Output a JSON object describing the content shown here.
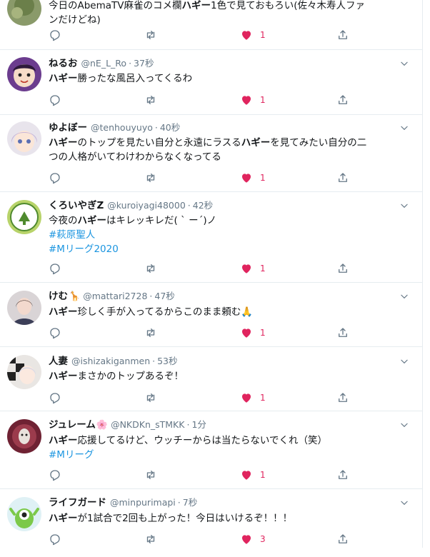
{
  "colors": {
    "accent": "#1b95e0",
    "like": "#e0245e",
    "muted": "#657786",
    "text": "#14171a",
    "divider": "#e6ecf0"
  },
  "icons": [
    "reply-icon",
    "retweet-icon",
    "heart-icon",
    "share-icon",
    "chevron-down-icon"
  ],
  "top_partial": {
    "text_part1": "今日のAbemaTV麻雀のコメ欄",
    "text_bold": "ハギー",
    "text_part2": "1色で見ておもろい(佐々木寿人ファ",
    "text_line2": "ンだけどね)",
    "likes": "1"
  },
  "tweets": [
    {
      "name": "ねるお",
      "handle": "@nE_L_Ro",
      "time": "37秒",
      "name_emoji": "",
      "lines": [
        [
          {
            "t": "ハギー",
            "b": true
          },
          {
            "t": "勝ったな風呂入ってくるわ"
          }
        ]
      ],
      "tags": [],
      "likes": "1"
    },
    {
      "name": "ゆよぼー",
      "handle": "@tenhouyuyo",
      "time": "40秒",
      "name_emoji": "",
      "lines": [
        [
          {
            "t": "ハギー",
            "b": true
          },
          {
            "t": "のトップを見たい自分と永遠にラスる"
          },
          {
            "t": "ハギー",
            "b": true
          },
          {
            "t": "を見てみたい自分の二"
          }
        ],
        [
          {
            "t": "つの人格がいてわけわからなくなってる"
          }
        ]
      ],
      "tags": [],
      "likes": "1"
    },
    {
      "name": "くろいやぎZ",
      "handle": "@kuroiyagi48000",
      "time": "42秒",
      "name_emoji": "",
      "lines": [
        [
          {
            "t": "今夜の"
          },
          {
            "t": "ハギー",
            "b": true
          },
          {
            "t": "はキレッキレだ( ˋ ー´)ノ"
          }
        ]
      ],
      "tags": [
        "#萩原聖人",
        "#Mリーグ2020"
      ],
      "likes": "1"
    },
    {
      "name": "けむ",
      "handle": "@mattari2728",
      "time": "47秒",
      "name_emoji": "🦒",
      "lines": [
        [
          {
            "t": "ハギー",
            "b": true
          },
          {
            "t": "珍しく手が入ってるからこのまま頼む🙏"
          }
        ]
      ],
      "tags": [],
      "likes": "1"
    },
    {
      "name": "人妻",
      "handle": "@ishizakiganmen",
      "time": "53秒",
      "name_emoji": "",
      "lines": [
        [
          {
            "t": "ハギー",
            "b": true
          },
          {
            "t": "まさかのトップあるぞ！"
          }
        ]
      ],
      "tags": [],
      "likes": "1"
    },
    {
      "name": "ジュレーム",
      "handle": "@NKDKn_sTMKK",
      "time": "1分",
      "name_emoji": "🌸",
      "lines": [
        [
          {
            "t": "ハギー",
            "b": true
          },
          {
            "t": "応援してるけど、ウッチーからは当たらないでくれ（笑）"
          }
        ]
      ],
      "tags": [
        "#Mリーグ"
      ],
      "likes": "1"
    },
    {
      "name": "ライフガード",
      "handle": "@minpurimapi",
      "time": "7秒",
      "name_emoji": "",
      "lines": [
        [
          {
            "t": "ハギー",
            "b": true
          },
          {
            "t": "が1試合で2回も上がった！今日はいけるぞ！！！"
          }
        ]
      ],
      "tags": [],
      "likes": "3"
    }
  ]
}
